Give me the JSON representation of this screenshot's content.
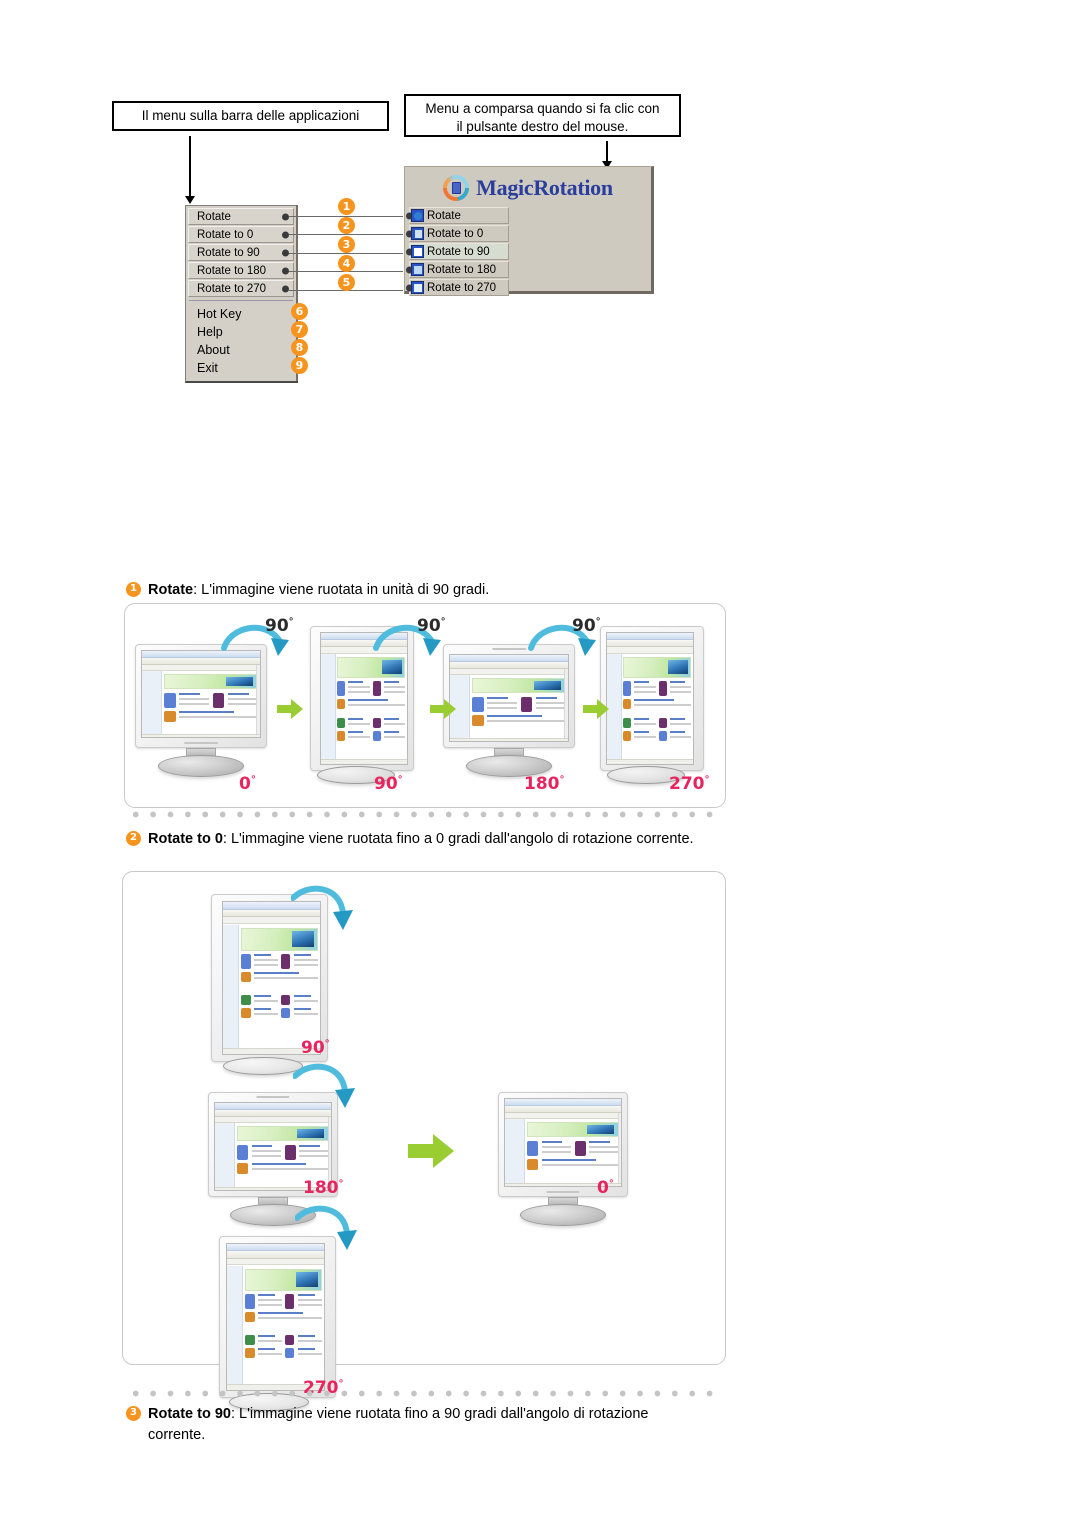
{
  "callouts": {
    "taskbar": "Il menu sulla barra delle applicazioni",
    "context_line1": "Menu a comparsa quando si fa clic con",
    "context_line2": "il pulsante destro del mouse."
  },
  "taskbar_menu": {
    "items": [
      {
        "label": "Rotate"
      },
      {
        "label": "Rotate to 0"
      },
      {
        "label": "Rotate to 90"
      },
      {
        "label": "Rotate to 180"
      },
      {
        "label": "Rotate to 270"
      }
    ],
    "commands": [
      {
        "label": "Hot Key"
      },
      {
        "label": "Help"
      },
      {
        "label": "About"
      },
      {
        "label": "Exit"
      }
    ]
  },
  "context_window": {
    "title": "MagicRotation",
    "logo_icon": "magicrotation-logo-icon",
    "items": [
      {
        "label": "Rotate",
        "icon": "rotate-icon"
      },
      {
        "label": "Rotate to 0",
        "icon": "rotate-to-0-icon"
      },
      {
        "label": "Rotate to 90",
        "icon": "rotate-to-90-icon"
      },
      {
        "label": "Rotate to 180",
        "icon": "rotate-to-180-icon"
      },
      {
        "label": "Rotate to 270",
        "icon": "rotate-to-270-icon"
      }
    ]
  },
  "badges": [
    "1",
    "2",
    "3",
    "4",
    "5",
    "6",
    "7",
    "8",
    "9"
  ],
  "descriptions": [
    {
      "num": "1",
      "bold": "Rotate",
      "text": ":  L'immagine viene ruotata in unità di 90 gradi."
    },
    {
      "num": "2",
      "bold": "Rotate to 0",
      "text": ": L'immagine viene ruotata fino a 0 gradi dall'angolo di rotazione corrente."
    },
    {
      "num": "3",
      "bold": "Rotate to 90",
      "text": ": L'immagine viene ruotata fino a 90 gradi dall'angolo di rotazione corrente."
    }
  ],
  "panel1": {
    "rotate_steps": [
      "90",
      "90",
      "90"
    ],
    "angle_labels": [
      "0",
      "90",
      "180",
      "270"
    ],
    "degree_symbol": "°"
  },
  "panel2": {
    "rotate_steps": [
      "90"
    ],
    "angle_labels": [
      "180",
      "0",
      "270"
    ],
    "degree_symbol": "°"
  },
  "colors": {
    "badge_orange": "#F6941E",
    "angle_pink": "#E8245E",
    "arrow_green": "#9ACD32",
    "arrow_blue": "#38A8CE",
    "brand_blue": "#2A3F9D"
  }
}
